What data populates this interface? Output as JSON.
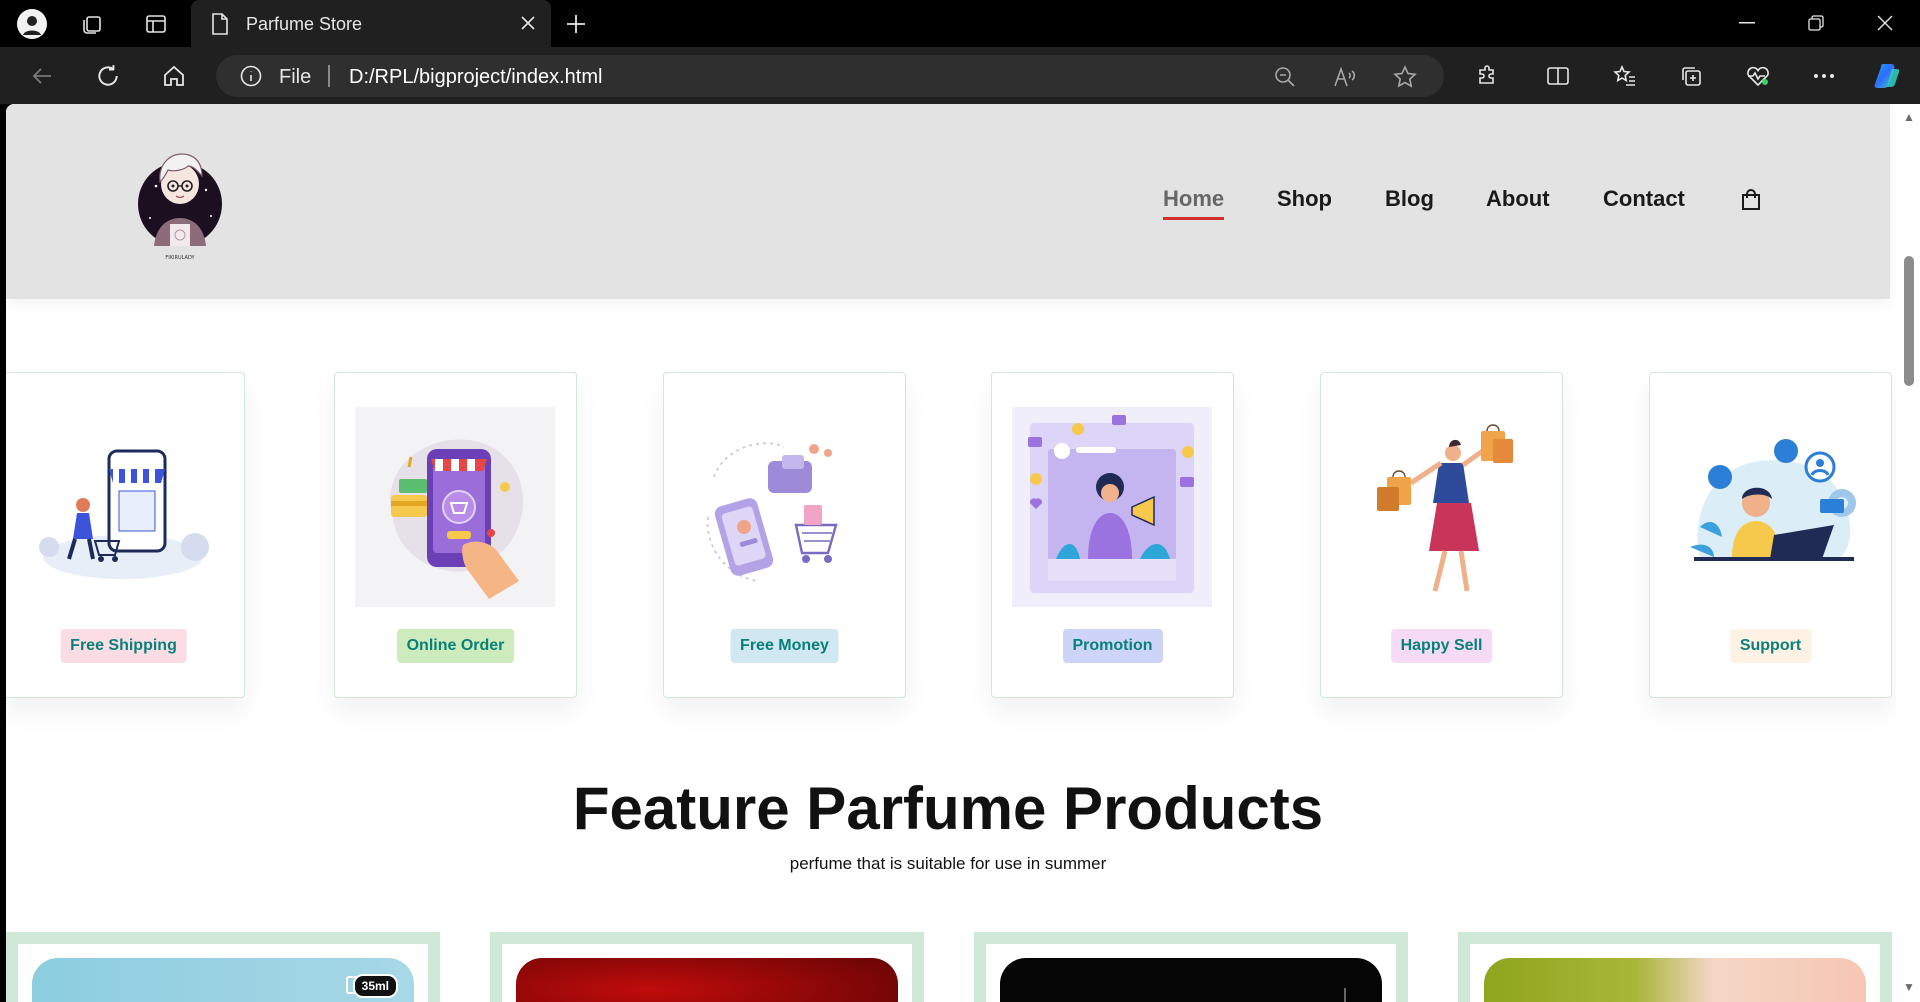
{
  "browser": {
    "tab_title": "Parfume Store",
    "omnibox_scheme": "File",
    "url": "D:/RPL/bigproject/index.html"
  },
  "site": {
    "nav": [
      "Home",
      "Shop",
      "Blog",
      "About",
      "Contact"
    ],
    "active_nav": "Home",
    "features": [
      {
        "label": "Free Shipping",
        "bg": "#fddde4"
      },
      {
        "label": "Online Order",
        "bg": "#cdebbc"
      },
      {
        "label": "Free Money",
        "bg": "#d1e8f2"
      },
      {
        "label": "Promotion",
        "bg": "#cdd4f8"
      },
      {
        "label": "Happy Sell",
        "bg": "#f6dbf6"
      },
      {
        "label": "Support",
        "bg": "#fff2e5"
      }
    ],
    "section_title": "Feature Parfume Products",
    "section_subtitle": "perfume that is suitable for use in summer",
    "products": [
      {
        "size_tag": "35ml",
        "image_color": "#8ecfe0"
      },
      {
        "size_tag": "",
        "image_color": "#9b0b0b"
      },
      {
        "size_tag": "",
        "image_color": "#050505"
      },
      {
        "size_tag": "",
        "image_color": "#8ea51c"
      }
    ]
  },
  "colors": {
    "accent_underline": "#d2302f",
    "badge_text": "#088178",
    "card_border": "#cfe8d8"
  }
}
